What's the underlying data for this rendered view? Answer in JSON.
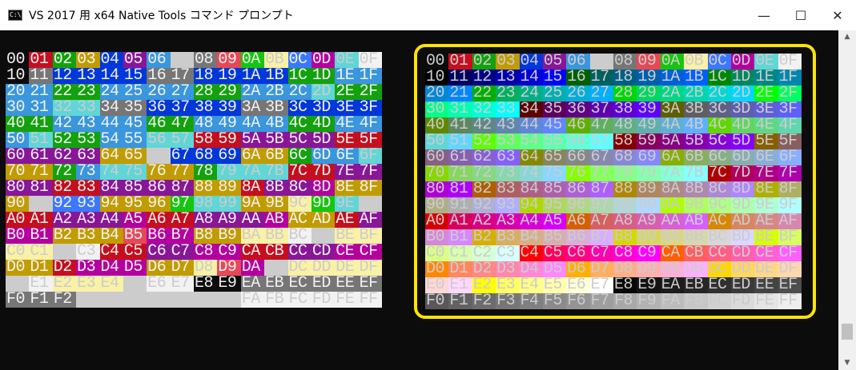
{
  "window": {
    "title": "VS 2017 用 x64 Native Tools コマンド プロンプト",
    "app_icon": "C:\\",
    "minimize": "—",
    "maximize": "☐",
    "close": "✕"
  },
  "colors": {
    "console_bg": "#0c0c0c",
    "highlight": "#ffe400",
    "ansi16": [
      "#0c0c0c",
      "#c50f1f",
      "#13a10e",
      "#c19c00",
      "#0037da",
      "#881798",
      "#3a96dd",
      "#cccccc",
      "#767676",
      "#e74856",
      "#16c60c",
      "#f9f1a5",
      "#3b78ff",
      "#b4009e",
      "#61d6d6",
      "#f2f2f2"
    ]
  },
  "labels": [
    "00 01 02 03 04 05 06 07 08 09 0A 0B 0C 0D 0E 0F",
    "10 11 12 13 14 15 16 17 18 19 1A 1B 1C 1D 1E 1F",
    "20 21 22 23 24 25 26 27 28 29 2A 2B 2C 2D 2E 2F",
    "30 31 32 33 34 35 36 37 38 39 3A 3B 3C 3D 3E 3F",
    "40 41 42 43 44 45 46 47 48 49 4A 4B 4C 4D 4E 4F",
    "50 51 52 53 54 55 56 57 58 59 5A 5B 5C 5D 5E 5F",
    "60 61 62 63 64 65 66 67 68 69 6A 6B 6C 6D 6E 6F",
    "70 71 72 73 74 75 76 77 78 79 7A 7B 7C 7D 7E 7F",
    "80 81 82 83 84 85 86 87 88 89 8A 8B 8C 8D 8E 8F",
    "90 91 92 93 94 95 96 97 98 99 9A 9B 9C 9D 9E 9F",
    "A0 A1 A2 A3 A4 A5 A6 A7 A8 A9 AA AB AC AD AE AF",
    "B0 B1 B2 B3 B4 B5 B6 B7 B8 B9 BA BB BC BD BE BF",
    "C0 C1 C2 C3 C4 C5 C6 C7 C8 C9 CA CB CC CD CE CF",
    "D0 D1 D2 D3 D4 D5 D6 D7 D8 D9 DA DB DC DD DE DF",
    "E0 E1 E2 E3 E4 E5 E6 E7 E8 E9 EA EB EC ED EE EF",
    "F0 F1 F2 F3 F4 F5 F6 F7 F8 F9 FA FB FC FD FE FF"
  ],
  "left_grid_ansi_rows": [
    "0123456789abcdef",
    "0844448844442266",
    "6622666622666e22",
    "66ee884444884444",
    "2266662266662266",
    "6e2266ee11555511",
    "555533744433266e",
    "3326ee332eee1155",
    "5511555533155d33",
    "37cc333aee33bae7",
    "11555d11555d3315",
    "dd3339dd33bbf7bb",
    "bb7f1155dd1155dd",
    "331ddd33b9d7bbbb",
    "7fbbb7ff00888888",
    "8887777777ffffff"
  ]
}
